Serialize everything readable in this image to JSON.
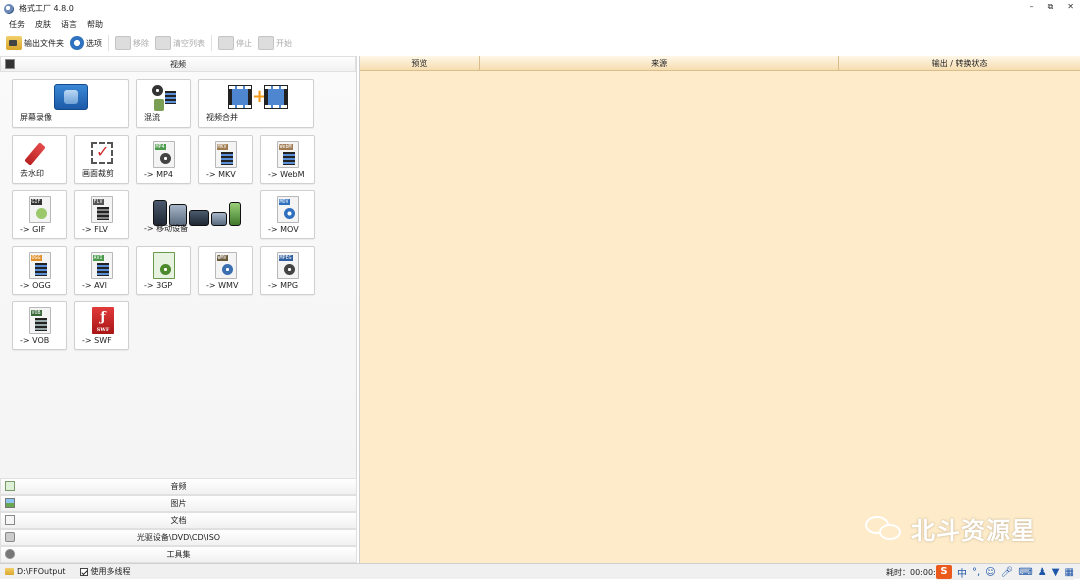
{
  "app": {
    "title": "格式工厂 4.8.0"
  },
  "window_controls": {
    "minimize": "–",
    "restore": "⧉",
    "close": "✕"
  },
  "menu": [
    "任务",
    "皮肤",
    "语言",
    "帮助"
  ],
  "toolbar": {
    "output_folder": "输出文件夹",
    "options": "选项",
    "remove": "移除",
    "clear_list": "清空列表",
    "stop": "停止",
    "start": "开始"
  },
  "left": {
    "video_category": "视频",
    "tiles": [
      {
        "label": "屏幕录像",
        "icon": "screen-record-icon"
      },
      {
        "label": "混流",
        "icon": "mux-icon"
      },
      {
        "label": "视频合并",
        "icon": "video-merge-icon"
      },
      {
        "label": "去水印",
        "icon": "remove-watermark-icon"
      },
      {
        "label": "画面裁剪",
        "icon": "crop-icon"
      },
      {
        "label": "-> MP4",
        "icon": "mp4-icon",
        "tag": "MP4"
      },
      {
        "label": "-> MKV",
        "icon": "mkv-icon",
        "tag": "MKV"
      },
      {
        "label": "-> WebM",
        "icon": "webm-icon",
        "tag": "WebM"
      },
      {
        "label": "-> GIF",
        "icon": "gif-icon",
        "tag": "GIF"
      },
      {
        "label": "-> FLV",
        "icon": "flv-icon",
        "tag": "FLV"
      },
      {
        "label": "-> 移动设备",
        "icon": "mobile-devices-icon"
      },
      {
        "label": "-> MOV",
        "icon": "mov-icon",
        "tag": "MOV"
      },
      {
        "label": "-> OGG",
        "icon": "ogg-icon",
        "tag": "OGG"
      },
      {
        "label": "-> AVI",
        "icon": "avi-icon",
        "tag": "AVI"
      },
      {
        "label": "-> 3GP",
        "icon": "3gp-icon",
        "tag": "3GP"
      },
      {
        "label": "-> WMV",
        "icon": "wmv-icon",
        "tag": "WMV"
      },
      {
        "label": "-> MPG",
        "icon": "mpg-icon",
        "tag": "MPEG"
      },
      {
        "label": "-> VOB",
        "icon": "vob-icon",
        "tag": "VOB"
      },
      {
        "label": "-> SWF",
        "icon": "swf-icon"
      }
    ],
    "categories": [
      "音频",
      "图片",
      "文档",
      "光驱设备\\DVD\\CD\\ISO",
      "工具集"
    ]
  },
  "table": {
    "columns": [
      "预览",
      "来源",
      "输出 / 转换状态"
    ]
  },
  "watermark": {
    "text": "北斗资源星"
  },
  "status": {
    "output_path": "D:\\FFOutput",
    "multithread": "使用多线程",
    "multithread_checked": true,
    "elapsed": "耗时：00:00:00"
  },
  "ime": {
    "mode": "中",
    "punct": "°,",
    "s_logo": "S"
  },
  "colors": {
    "list_bg": "#fdebc9",
    "accent_orange": "#f29a1a",
    "ime_orange": "#ea5a1c"
  }
}
